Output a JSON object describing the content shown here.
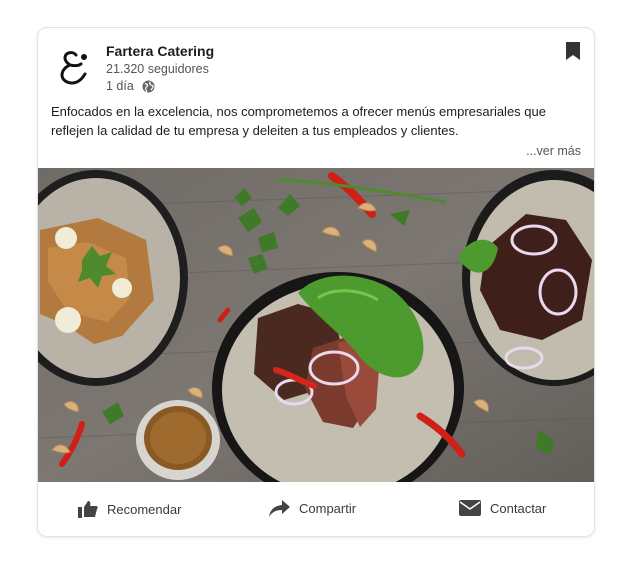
{
  "post": {
    "company_name": "Fartera Catering",
    "followers": "21.320 seguidores",
    "time": "1 día",
    "description": "Enfocados en la excelencia, nos comprometemos a ofrecer menús empresariales que reflejen la calidad de tu empresa y deleiten a tus empleados y clientes.",
    "see_more": "...ver más"
  },
  "actions": {
    "recommend": "Recomendar",
    "share": "Compartir",
    "contact": "Contactar"
  },
  "icons": {
    "logo": "ampersand-logo",
    "globe": "globe-icon",
    "bookmark": "bookmark-icon",
    "recommend": "thumbs-up-icon",
    "share": "share-arrow-icon",
    "contact": "envelope-icon"
  }
}
